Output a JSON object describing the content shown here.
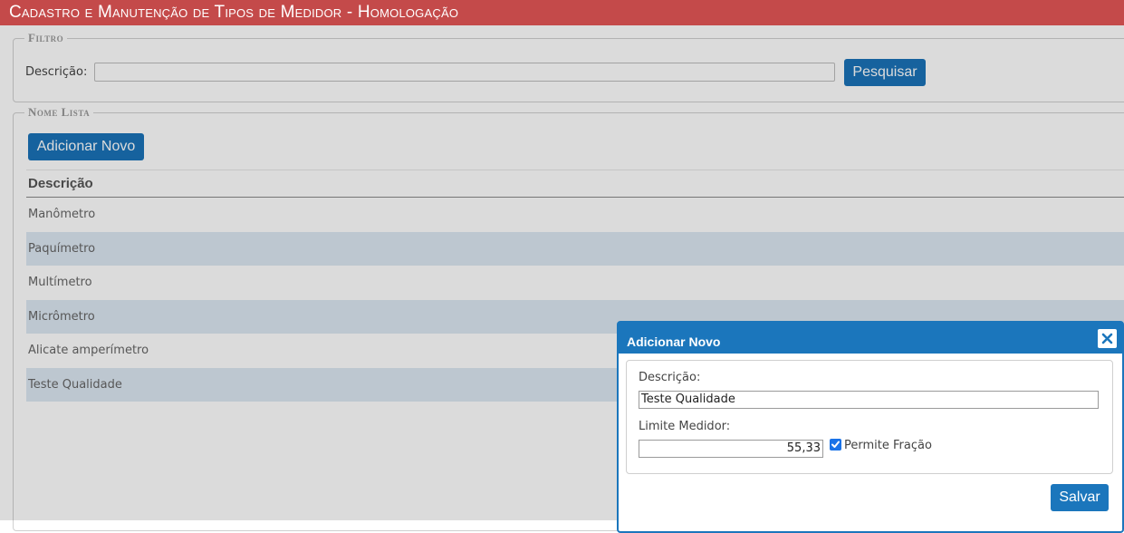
{
  "header": {
    "title": "Cadastro e Manutenção de Tipos de Medidor  - Homologação"
  },
  "filtro": {
    "legend": "Filtro",
    "descricao_label": "Descrição:",
    "descricao_value": "",
    "search_button": "Pesquisar"
  },
  "lista": {
    "legend": "Nome Lista",
    "add_button": "Adicionar Novo",
    "column_header": "Descrição",
    "rows": [
      "Manômetro",
      "Paquímetro",
      "Multímetro",
      "Micrômetro",
      "Alicate amperímetro",
      "Teste Qualidade"
    ]
  },
  "dialog": {
    "title": "Adicionar Novo",
    "close_icon": "close-icon",
    "descricao_label": "Descrição:",
    "descricao_value": "Teste Qualidade",
    "limite_label": "Limite Medidor:",
    "limite_value": "55,33",
    "permite_fracao_label": "Permite Fração",
    "permite_fracao_checked": true,
    "save_button": "Salvar"
  },
  "colors": {
    "titlebar": "#c44a4a",
    "primary": "#1b76bc",
    "row_alt": "#dde8f3"
  }
}
